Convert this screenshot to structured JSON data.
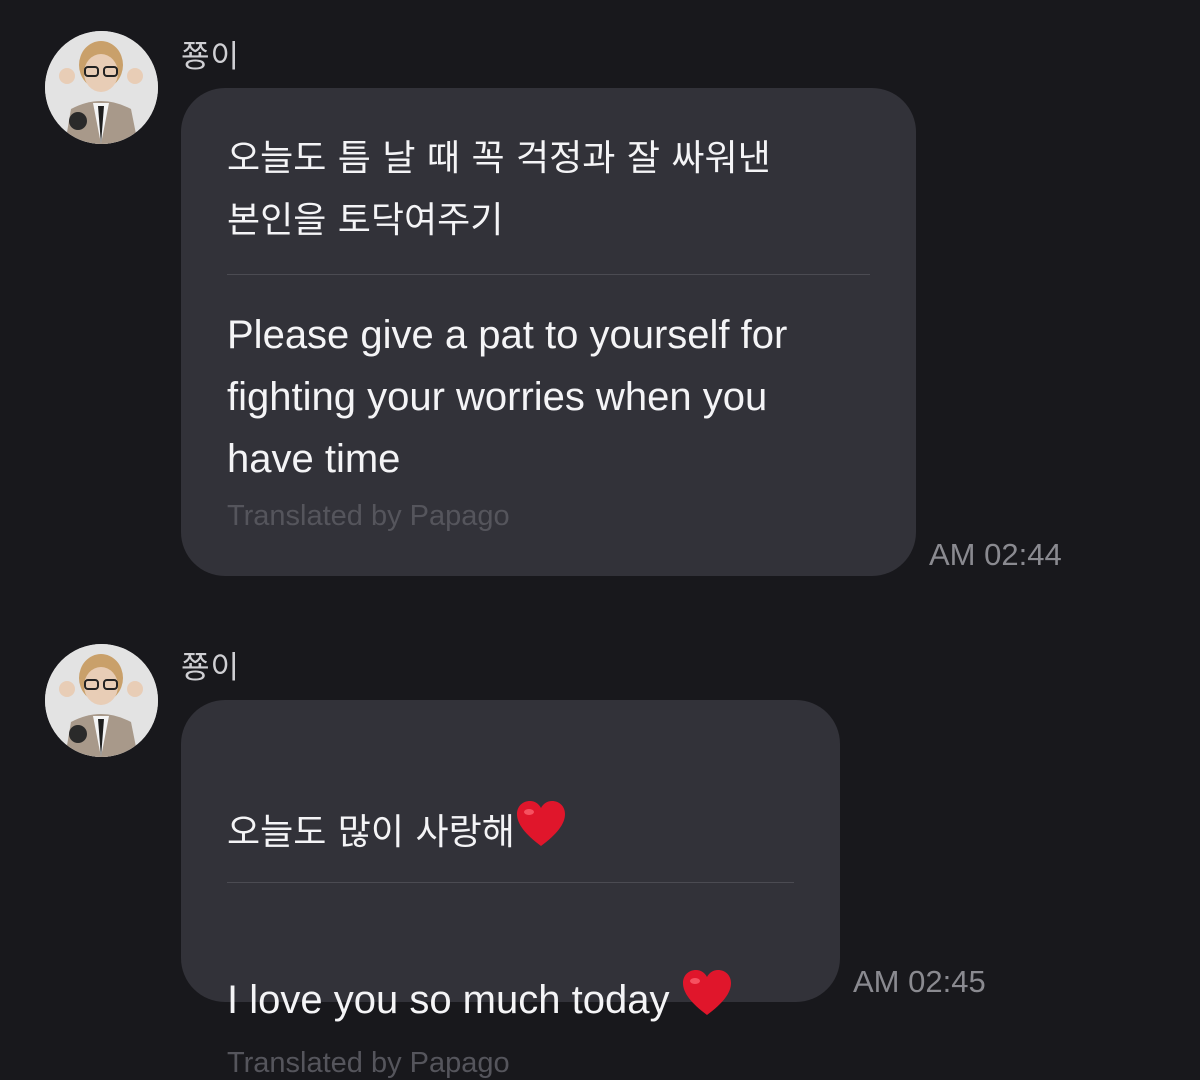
{
  "messages": [
    {
      "sender": "쭁이",
      "original": "오늘도 틈 날 때 꼭 걱정과 잘 싸워낸\n본인을 토닥여주기",
      "translation": "Please give a pat to yourself for\nfighting your worries when you\nhave time",
      "credit": "Translated by Papago",
      "time": "AM 02:44"
    },
    {
      "sender": "쭁이",
      "original": "오늘도 많이 사랑해",
      "original_emoji": "heart-emoji",
      "translation": "I love you so much today ",
      "translation_emoji": "heart-emoji",
      "credit": "Translated by Papago",
      "time": "AM 02:45"
    }
  ],
  "colors": {
    "background": "#18181c",
    "bubble": "#323239",
    "heart": "#e0162b"
  }
}
